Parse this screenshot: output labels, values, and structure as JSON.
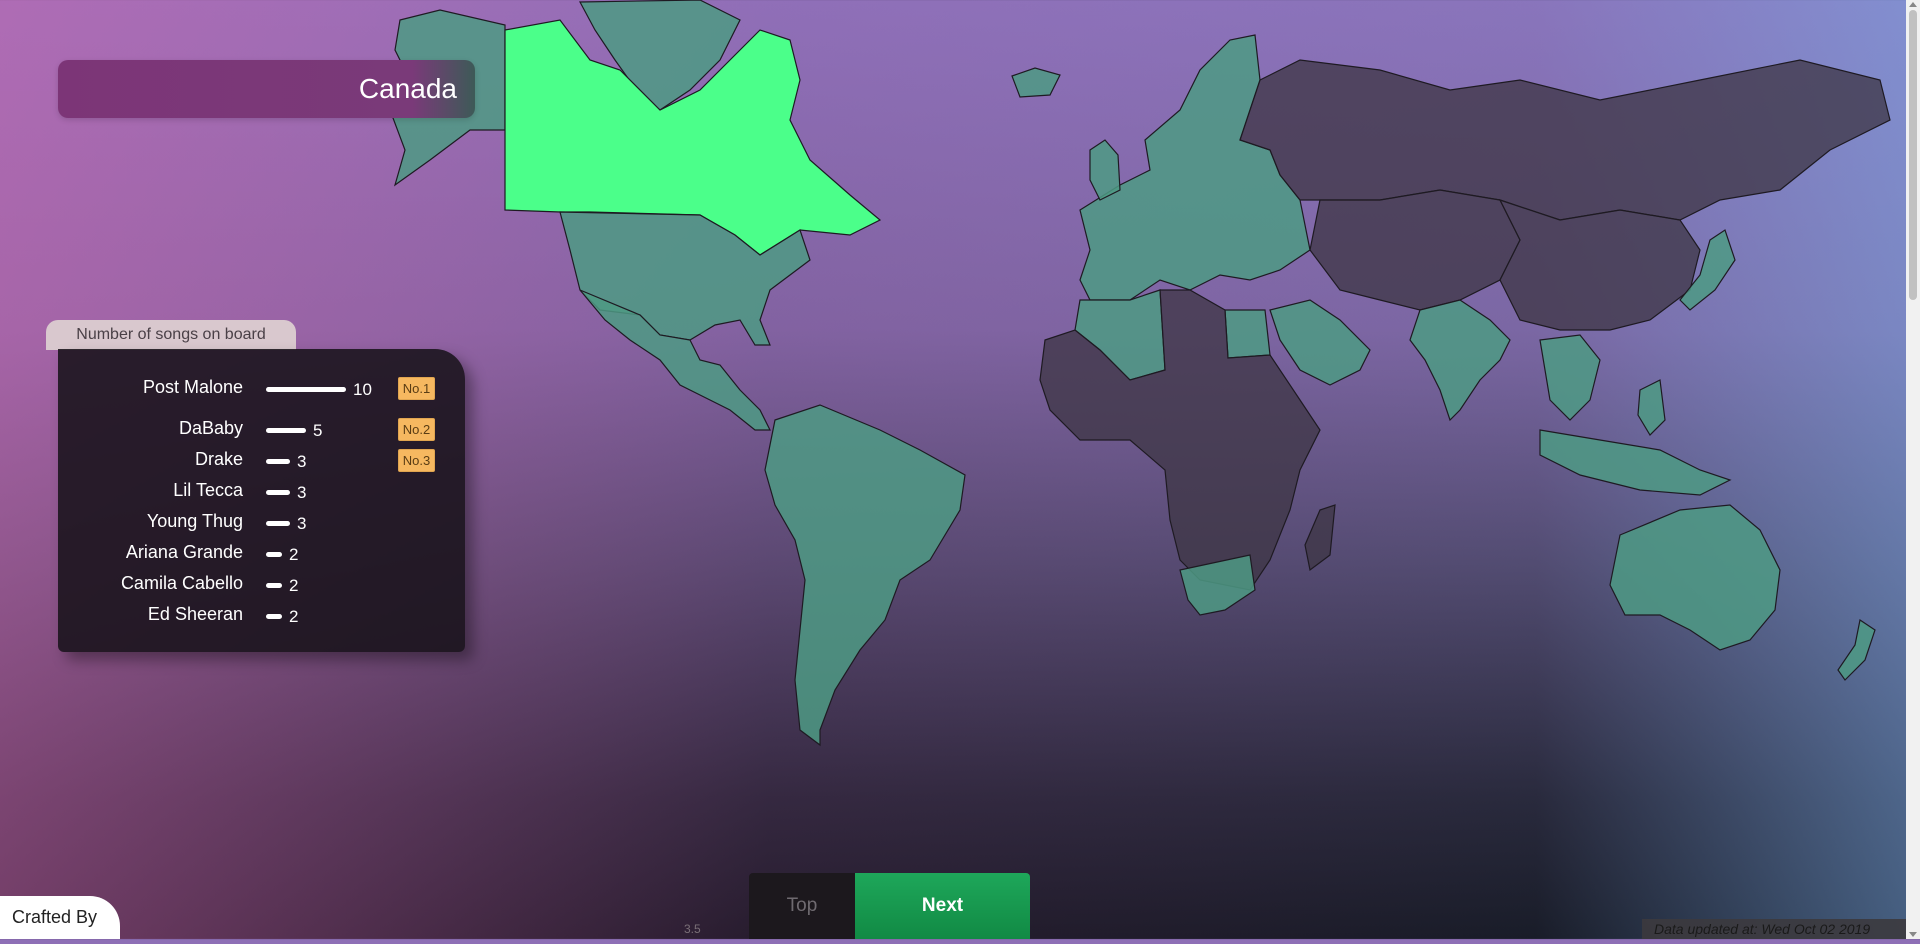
{
  "map": {
    "selected_country": "Canada",
    "colors": {
      "selected": "#4bff8a",
      "charting": "#4d9a84",
      "not_charting": "#3d3644",
      "border": "#1e1a22"
    }
  },
  "panel": {
    "tab_label": "Number of songs on board",
    "artists": [
      {
        "name": "Post Malone",
        "songs": 10,
        "rank_badge": "No.1"
      },
      {
        "name": "DaBaby",
        "songs": 5,
        "rank_badge": "No.2"
      },
      {
        "name": "Drake",
        "songs": 3,
        "rank_badge": "No.3"
      },
      {
        "name": "Lil Tecca",
        "songs": 3,
        "rank_badge": ""
      },
      {
        "name": "Young Thug",
        "songs": 3,
        "rank_badge": ""
      },
      {
        "name": "Ariana Grande",
        "songs": 2,
        "rank_badge": ""
      },
      {
        "name": "Camila Cabello",
        "songs": 2,
        "rank_badge": ""
      },
      {
        "name": "Ed Sheeran",
        "songs": 2,
        "rank_badge": ""
      }
    ]
  },
  "footer": {
    "crafted_by": "Crafted By",
    "version": "3.5",
    "top_button": "Top",
    "next_button": "Next",
    "data_updated": "Data updated at: Wed Oct 02 2019"
  }
}
